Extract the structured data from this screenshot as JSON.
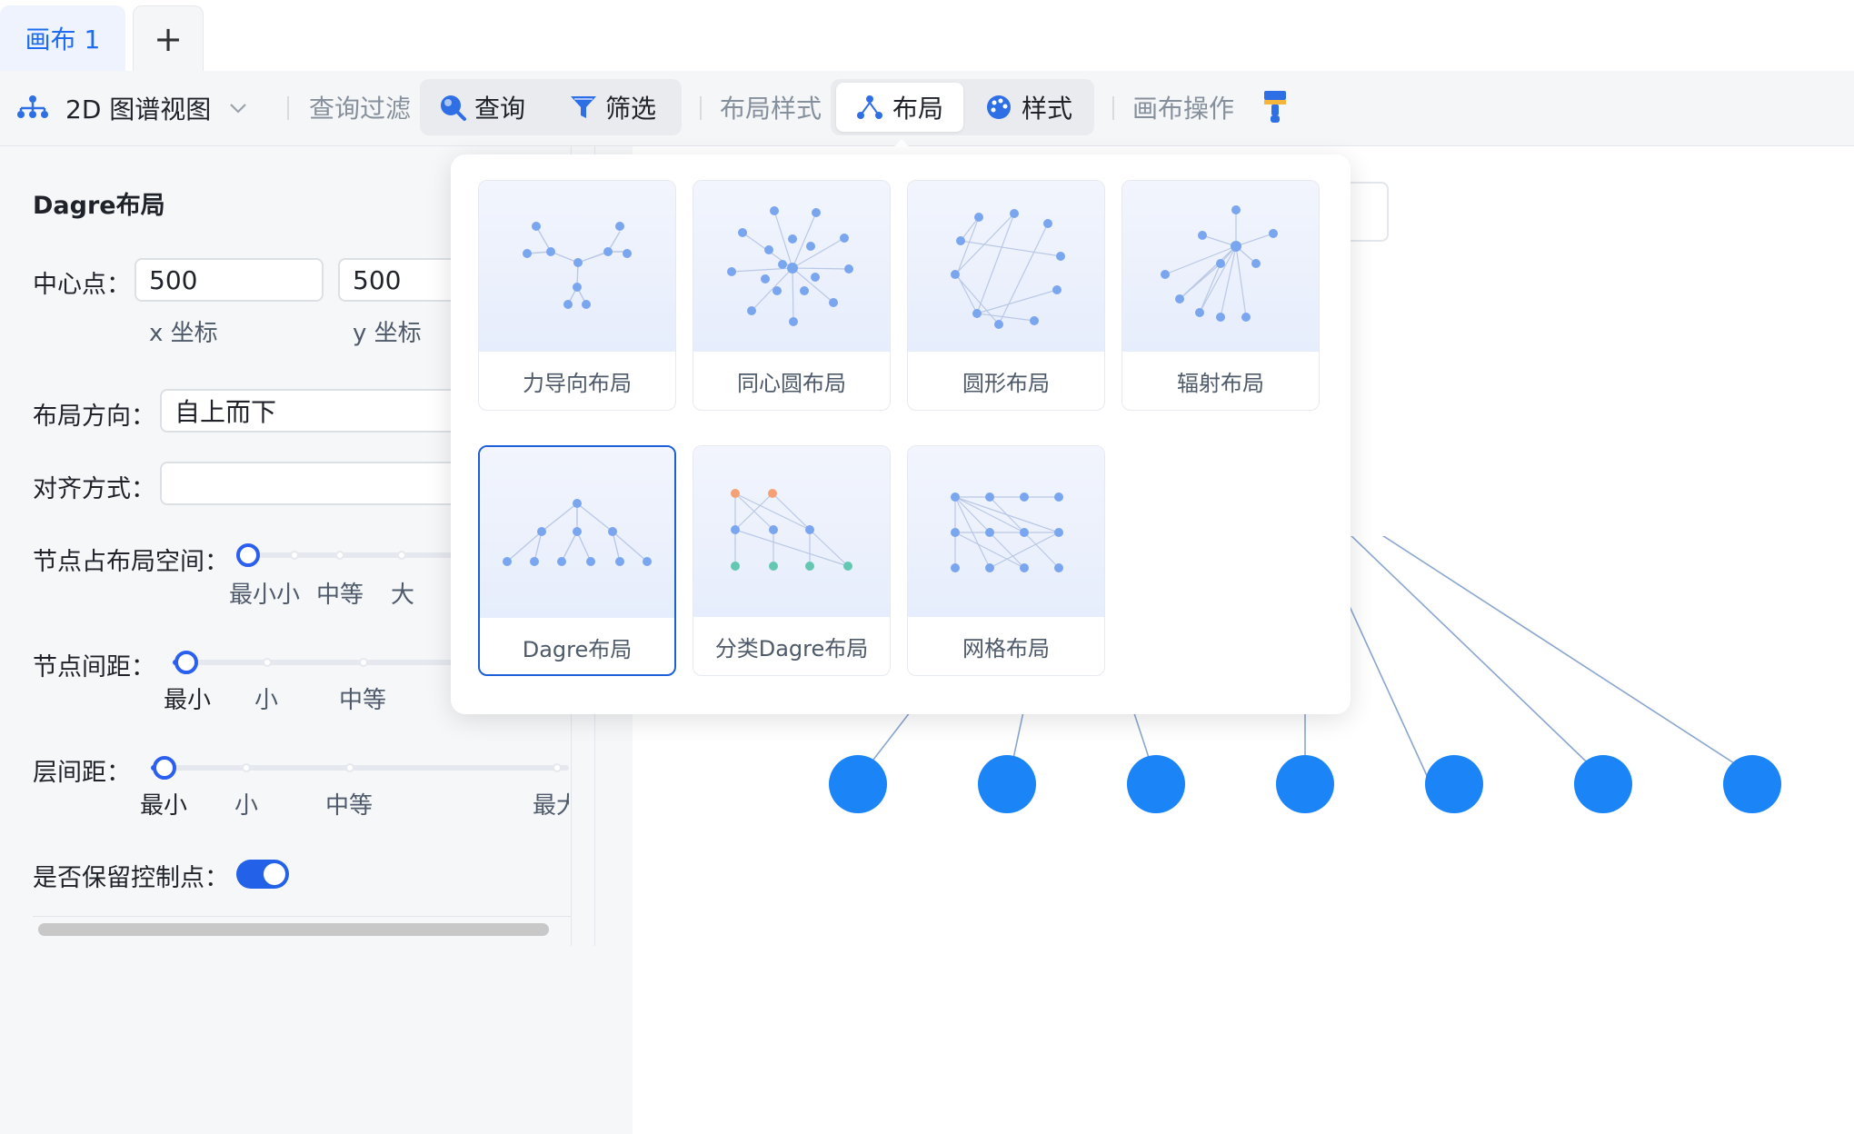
{
  "tabs": {
    "active_label": "画布 1",
    "add_label": "+"
  },
  "toolbar": {
    "view_label": "2D 图谱视图",
    "query_filter_group": "查询过滤",
    "query_label": "查询",
    "filter_label": "筛选",
    "layout_style_group": "布局样式",
    "layout_label": "布局",
    "style_label": "样式",
    "canvas_ops_group": "画布操作"
  },
  "panel": {
    "title": "Dagre布局",
    "center_label": "中心点：",
    "center_x": "500",
    "center_y": "500",
    "x_caption": "x 坐标",
    "y_caption": "y 坐标",
    "direction_label": "布局方向：",
    "direction_value": "自上而下",
    "align_label": "对齐方式：",
    "align_value": "",
    "node_space_label": "节点占布局空间：",
    "node_space_ticks": [
      "最小",
      "小",
      "中等",
      "大"
    ],
    "node_gap_label": "节点间距：",
    "node_gap_ticks": [
      "最小",
      "小",
      "中等"
    ],
    "rank_gap_label": "层间距：",
    "rank_gap_ticks": [
      "最小",
      "小",
      "中等",
      "最大"
    ],
    "keep_control_label": "是否保留控制点：",
    "keep_control_on": true
  },
  "layouts": [
    {
      "label": "力导向布局",
      "icon": "force-layout-icon"
    },
    {
      "label": "同心圆布局",
      "icon": "concentric-layout-icon"
    },
    {
      "label": "圆形布局",
      "icon": "circular-layout-icon"
    },
    {
      "label": "辐射布局",
      "icon": "radial-layout-icon"
    },
    {
      "label": "Dagre布局",
      "icon": "dagre-layout-icon",
      "selected": true
    },
    {
      "label": "分类Dagre布局",
      "icon": "category-dagre-layout-icon"
    },
    {
      "label": "网格布局",
      "icon": "grid-layout-icon"
    }
  ],
  "colors": {
    "accent": "#1f6cf0",
    "node": "#1b85f7",
    "edge": "#8aa6cf",
    "selected_border": "#1d5fd6"
  }
}
